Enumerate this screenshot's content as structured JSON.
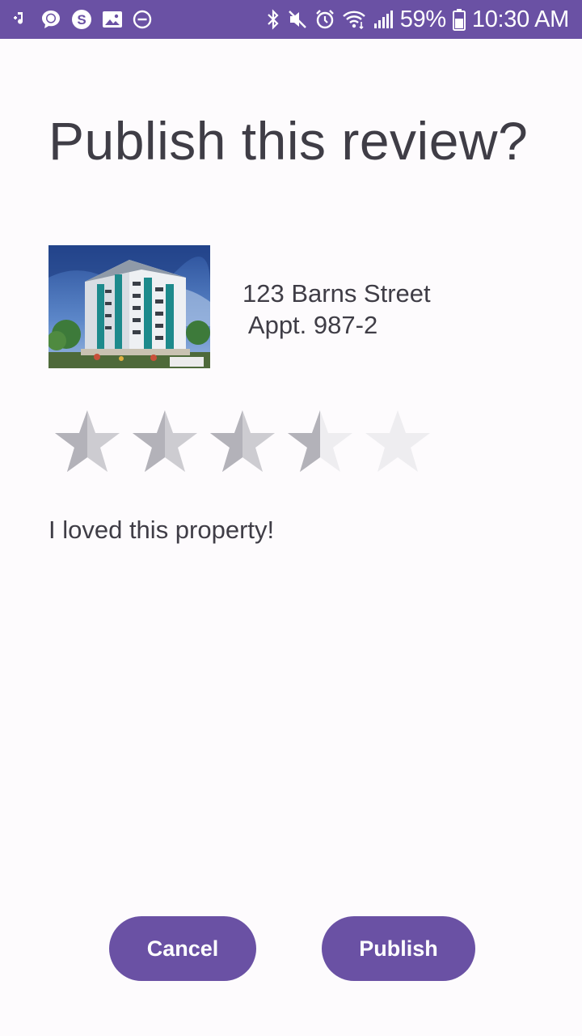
{
  "status_bar": {
    "battery": "59%",
    "time": "10:30 AM",
    "left_icons": [
      "music-icon",
      "chat-bubble-icon",
      "skype-icon",
      "image-icon",
      "do-not-disturb-icon"
    ],
    "right_icons": [
      "bluetooth-icon",
      "mute-icon",
      "alarm-icon",
      "wifi-icon",
      "signal-icon",
      "battery-icon"
    ],
    "color": "#6a51a4"
  },
  "dialog": {
    "title": "Publish this review?",
    "property": {
      "address_line1": "123 Barns Street",
      "address_line2": " Appt. 987-2",
      "photo_icon": "building-photo"
    },
    "rating": {
      "value": 3.5,
      "max": 5
    },
    "review_text": "I loved this property!"
  },
  "buttons": {
    "cancel_label": "Cancel",
    "publish_label": "Publish",
    "accent_color": "#6a51a4"
  }
}
